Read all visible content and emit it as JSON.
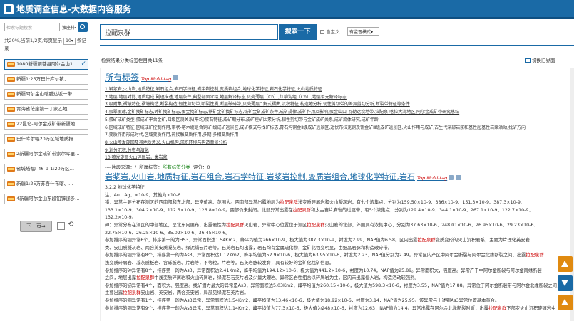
{
  "app": {
    "title": "地质调查信息-大数据内容服务"
  },
  "left": {
    "search_placeholder": "检索标题搜索",
    "select": "独座排▾",
    "info1": "共20%,当前1/2页,每页显示",
    "per_page": "10▾",
    "info2": "条记录",
    "items": [
      "1080新疆前苍县阿尔金山1…",
      "新疆1:25万巴什库尔镇、…",
      "新疆阿尔金山喀腊达坂一带…",
      "青海省茫崖镇一丁家乙地…",
      "22昆仑-阿尔金成矿带新疆地…",
      "巴什库尔幅20万区域地质报…",
      "2新疆阿尔金成矿带索尔库里…",
      "省城塔幅I-46-9 1:20万区…",
      "新疆1:25万苏吾什布喀、…",
      "4新疆阿尔金山东段铅锌锑多…"
    ],
    "next": "下一页➡"
  },
  "search": {
    "value": "拉配泉群",
    "button": "搜索一下",
    "opt1": "自定义",
    "opt2": "有监督模式▾"
  },
  "results": {
    "info": "检索结果分类标签栏目共11条",
    "switch": "切换旧界面"
  },
  "tags": {
    "title": "所有标签",
    "multi": "Top  Multi-tag"
  },
  "links": [
    "1.岩浆岩,火山岩,地质特征,岩石组合,岩石学特征,岩浆岩控制,变质岩组合,地球化学特征,岩石化学特征,火山地质特征",
    "2.地层,地层对比,地质组成,副理描述,地层条件,典型剖面介绍,地层解译标志,贝壳薄层（Ch）,红柳沟组（Ch）,地层单元解译标志",
    "3.吸附集,褶皱特征,褶皱构造,断裂构造,韧性剪切带,断裂性质,断层破碎带,贝壳薄层“ 解式褶曲,沉积特征,构造地分析,韧性剪切带的差异剪切分析,断裂带特征等条件",
    "4.蛋翠蛋球,金矿找矿标志,钟矿找矿标志,蛋金找矿标志,铁矿金矿找矿标志,铁矿金矿成矿条件,成矿规律,成矿作用及影响,蛋金山口-瓦勒达坎地带,拉配泉-喀拉大湾地区,阿尔金成矿带研究总结",
    "5.蛋矿成矿类型,蛋成矿平台金矿,四级区测关系(平均)蛋石特征,成矿期分布,成矿控矿因素分析,韧性剪切带与金矿成矿关系,成矿流体研究,成矿年龄",
    "6.区域成矿特征,区域成矿控制作用,带状-喀木塘组合铜矿Ⅰ级成矿远景区,成矿模式与找矿标志,青石沟铜金Ⅱ级成矿远景区,遥伏布拉克铜及锡金矿Ⅲ级成矿远景区,火山作用与成矿,古生代深部岩浆和基性超基性岩浆活动,找矿方向",
    "7.变质作用形成时代,区域变质作用,热接触变质作用,多期,多相变质作用",
    "8.火山喷发旋回及其地质意义,火山机构,沉积环境与构造背景分析",
    "9.划分沉积,分布与演化",
    "10.喷发旋回火山碎屑岩，类岩浆"
  ],
  "cls": {
    "a": "----片段来源：/",
    "b": "所属标签：",
    "c": "所有标签分类",
    "d": "评分：0"
  },
  "h2": {
    "text": "岩浆岩,火山岩,地质特征,岩石组合,岩石学特征,岩浆岩控制,变质岩组合,地球化学特征,岩石",
    "multi": "Top  Multi-tag"
  },
  "body": [
    "3.2.2 地球化学特征",
    "注：Au、Ag：×10-9，其他为×10-6",
    "锑：异常主要分布在测区的西南部和东北部，异常值高、范围大。西南部异常出露地层为拉配泉群浅变质碎屑岩和火山凝灰岩，有七个浓集点，分别为159.50×10-9、386×10-9、151.3×10-9、387.3×10-9、",
    "133.1×10-9、304.2×10-9、112.5×10-9、126.8×10-9。西部仍未封闭。北部异常出露在拉配泉群和太古宙片麻岩的过渡带，有5个浓集点，分别为129.4×10-9、344.1×10-9、267.1×10-9、122.7×10-9、",
    "132.2×10-9。",
    "砷：异常分布在测区的中部地区，呈北东向展布，出露岩性为拉配泉群火山岩，异常中心位置位于测区拉配泉群火山岩的北部，外围具有浓集中心，分别为37.63×10-6、248.01×10-6、26.95×10-6、29.23×10-6、",
    "22.75×10-6、26.25×10-6、35.02×10-6、36.45×10-6。",
    "参加排序的铜异常6个，排序第一的为HS3，异常面积达1.54Km2，峰平均值为266×10-9，极大值为387.3×10-9，衬度为2.99，NAP值为6.58。区内出露拉配泉群变质变形的火山沉积岩系，主要为片理化英安岩",
    "类、安山质凝灰岩、两合英安质凝灰岩、绿泥绢云片岩等，石英岩石均出露，岩石均有金属硫化物，金矿化蚀变明显，由细晶岩脉和构造破碎带。",
    "参加排序的铜异常有8个，排序第一的为As3，异常面积达1.12Km2，峰平均值为52.9×10-6，极大值为63.95×10-6，衬度为2.23，NAP值分别为2.49。异常区内产区中阿尔金断裂与阿尔金北缘断裂之间，出露拉配泉群",
    "浅变质碎屑岩、凝灰质板岩、含砾板岩、片岩等，不等粒，片岩等。石英岩脉较发育，具有较好的金矿化找矿信息。",
    "参加排序的砷异常有8个，排序第一的为As3，异常面积达2.41Km2，峰平均值为194.12×10-6，极大值为441.2×10-6，衬度为10.74，NAP值为25.89。异常面积大，强度高。异常产于中阿尔金断裂与阿尔金南缘断裂",
    "之间，地层出露拉配泉群中浅变质碎屑岩和火山碎屑岩，绿泥石石英片岩及少量大理岩。异常区岩性组合以碎屑岩为主，区内未出露侵入岩，构造活动较强烈。",
    "参加排序的锑异常有4个，面积大、强度高。找矿潜力最大的异常是As3，异常面积达5.03Km2，峰平均值为260.15×10-6，极大值为598.3×10-6，衬度为3.55，NAP值为17.88。异常位于阿尔金断裂带与阿尔金北缘断裂之间，",
    "主要出露拉配泉群安山岩、英安岩，两合英安岩，局部见绿泥石英片岩。",
    "参加排序的铜异常有1个，排序第一的为As3异常，异常面积达1.54Km2，峰平均值为13.46×10-6，极大值为18.92×10-6，衬度为3.14，NAP值为25.95。该异常与上述铜As3异常位置基本重合。",
    "参加排序的铜异常有9个，排序第一的为As3异常，异常面积达1.14Km2，峰平均值为77.3×10-6，极大值为248×10-6，衬度为12.63，NAP值为14.4。异常出露在阿尔金北缘断裂附近，出露拉配泉群下部变火山沉积碎屑岩中"
  ]
}
